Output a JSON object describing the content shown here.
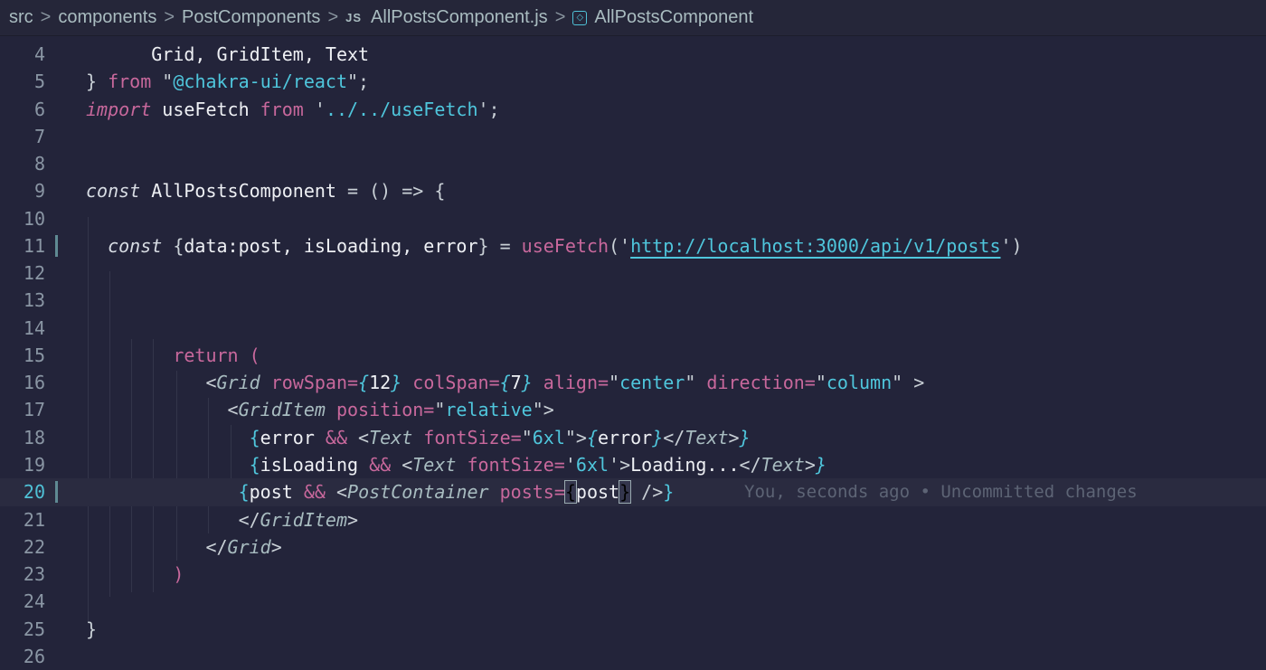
{
  "breadcrumb": {
    "items": [
      "src",
      "components",
      "PostComponents",
      "AllPostsComponent.js",
      "AllPostsComponent"
    ],
    "file_badge": "JS",
    "separator": ">"
  },
  "editor": {
    "active_line": 20,
    "blame": "You, seconds ago • Uncommitted changes",
    "lines": [
      {
        "n": 4,
        "t": [
          [
            "id",
            "      Grid, GridItem, Text"
          ]
        ]
      },
      {
        "n": 5,
        "t": [
          [
            "p",
            "} "
          ],
          [
            "kw",
            "from"
          ],
          [
            "p",
            " \""
          ],
          [
            "str",
            "@chakra-ui/react"
          ],
          [
            "p",
            "\";"
          ]
        ]
      },
      {
        "n": 6,
        "t": [
          [
            "kwi",
            "import"
          ],
          [
            "id",
            " useFetch "
          ],
          [
            "kw",
            "from"
          ],
          [
            "p",
            " '"
          ],
          [
            "str",
            "../../useFetch"
          ],
          [
            "p",
            "';"
          ]
        ]
      },
      {
        "n": 7,
        "t": []
      },
      {
        "n": 8,
        "t": []
      },
      {
        "n": 9,
        "t": [
          [
            "dec",
            "const"
          ],
          [
            "id",
            " AllPostsComponent "
          ],
          [
            "p",
            "= () => {"
          ]
        ]
      },
      {
        "n": 10,
        "t": []
      },
      {
        "n": 11,
        "t": [
          [
            "dec",
            "  const"
          ],
          [
            "p",
            " {"
          ],
          [
            "id",
            "data:post, isLoading, error"
          ],
          [
            "p",
            "} = "
          ],
          [
            "fn",
            "useFetch"
          ],
          [
            "p",
            "('"
          ],
          [
            "url",
            "http://localhost:3000/api/v1/posts"
          ],
          [
            "p",
            "')"
          ]
        ],
        "mark": true
      },
      {
        "n": 12,
        "t": []
      },
      {
        "n": 13,
        "t": []
      },
      {
        "n": 14,
        "t": []
      },
      {
        "n": 15,
        "t": [
          [
            "kw",
            "        return"
          ],
          [
            "kw",
            " ("
          ]
        ]
      },
      {
        "n": 16,
        "t": [
          [
            "p",
            "           <"
          ],
          [
            "tag",
            "Grid"
          ],
          [
            "kw",
            " rowSpan="
          ],
          [
            "bri",
            "{"
          ],
          [
            "id",
            "12"
          ],
          [
            "bri",
            "}"
          ],
          [
            "kw",
            " colSpan="
          ],
          [
            "bri",
            "{"
          ],
          [
            "id",
            "7"
          ],
          [
            "bri",
            "}"
          ],
          [
            "kw",
            " align="
          ],
          [
            "p",
            "\""
          ],
          [
            "str",
            "center"
          ],
          [
            "p",
            "\""
          ],
          [
            "kw",
            " direction="
          ],
          [
            "p",
            "\""
          ],
          [
            "str",
            "column"
          ],
          [
            "p",
            "\" >"
          ]
        ]
      },
      {
        "n": 17,
        "t": [
          [
            "p",
            "             <"
          ],
          [
            "tag",
            "GridItem"
          ],
          [
            "kw",
            " position="
          ],
          [
            "p",
            "\""
          ],
          [
            "str",
            "relative"
          ],
          [
            "p",
            "\">"
          ]
        ]
      },
      {
        "n": 18,
        "t": [
          [
            "br",
            "               {"
          ],
          [
            "id",
            "error "
          ],
          [
            "kw",
            "&&"
          ],
          [
            "p",
            " <"
          ],
          [
            "tag",
            "Text"
          ],
          [
            "kw",
            " fontSize="
          ],
          [
            "p",
            "\""
          ],
          [
            "str",
            "6xl"
          ],
          [
            "p",
            "\">"
          ],
          [
            "bri",
            "{"
          ],
          [
            "id",
            "error"
          ],
          [
            "bri",
            "}"
          ],
          [
            "p",
            "</"
          ],
          [
            "tag",
            "Text"
          ],
          [
            "p",
            ">"
          ],
          [
            "bri",
            "}"
          ]
        ]
      },
      {
        "n": 19,
        "t": [
          [
            "br",
            "               {"
          ],
          [
            "id",
            "isLoading "
          ],
          [
            "kw",
            "&&"
          ],
          [
            "p",
            " <"
          ],
          [
            "tag",
            "Text"
          ],
          [
            "kw",
            " fontSize="
          ],
          [
            "p",
            "'"
          ],
          [
            "str",
            "6xl"
          ],
          [
            "p",
            "'>"
          ],
          [
            "id",
            "Loading..."
          ],
          [
            "p",
            "</"
          ],
          [
            "tag",
            "Text"
          ],
          [
            "p",
            ">"
          ],
          [
            "bri",
            "}"
          ]
        ]
      },
      {
        "n": 20,
        "t": [
          [
            "br",
            "              {"
          ],
          [
            "id",
            "post "
          ],
          [
            "kw",
            "&&"
          ],
          [
            "p",
            " <"
          ],
          [
            "tag",
            "PostContainer"
          ],
          [
            "kw",
            " posts="
          ],
          [
            "cur",
            "{"
          ],
          [
            "id",
            "post"
          ],
          [
            "cur",
            "}"
          ],
          [
            "p",
            " />"
          ],
          [
            "br",
            "}"
          ]
        ],
        "mark": true
      },
      {
        "n": 21,
        "t": [
          [
            "p",
            "              </"
          ],
          [
            "tag",
            "GridItem"
          ],
          [
            "p",
            ">"
          ]
        ]
      },
      {
        "n": 22,
        "t": [
          [
            "p",
            "           </"
          ],
          [
            "tag",
            "Grid"
          ],
          [
            "p",
            ">"
          ]
        ]
      },
      {
        "n": 23,
        "t": [
          [
            "kw",
            "        )"
          ]
        ]
      },
      {
        "n": 24,
        "t": []
      },
      {
        "n": 25,
        "t": [
          [
            "p",
            "}"
          ]
        ]
      },
      {
        "n": 26,
        "t": []
      }
    ]
  }
}
